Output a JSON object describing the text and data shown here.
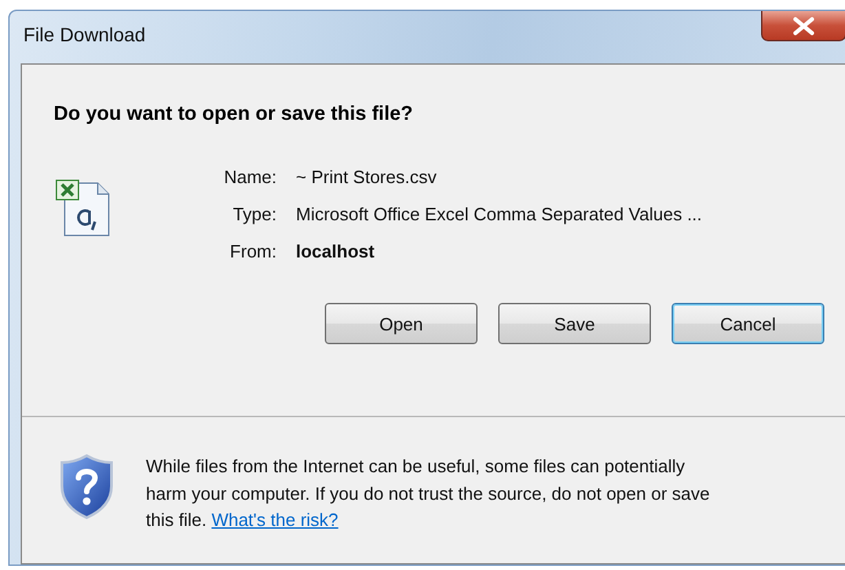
{
  "window": {
    "title": "File Download"
  },
  "heading": "Do you want to open or save this file?",
  "details": [
    {
      "label": "Name:",
      "value": "~ Print Stores.csv",
      "kind": "plain"
    },
    {
      "label": "Type:",
      "value": "Microsoft Office Excel Comma Separated Values ...",
      "kind": "plain"
    },
    {
      "label": "From:",
      "value": "localhost",
      "kind": "bold"
    }
  ],
  "buttons": [
    {
      "label": "Open",
      "default": false
    },
    {
      "label": "Save",
      "default": false
    },
    {
      "label": "Cancel",
      "default": true
    }
  ],
  "warning": {
    "text": "While files from the Internet can be useful, some files can potentially harm your computer. If you do not trust the source, do not open or save this file.",
    "link": "What's the risk?"
  }
}
